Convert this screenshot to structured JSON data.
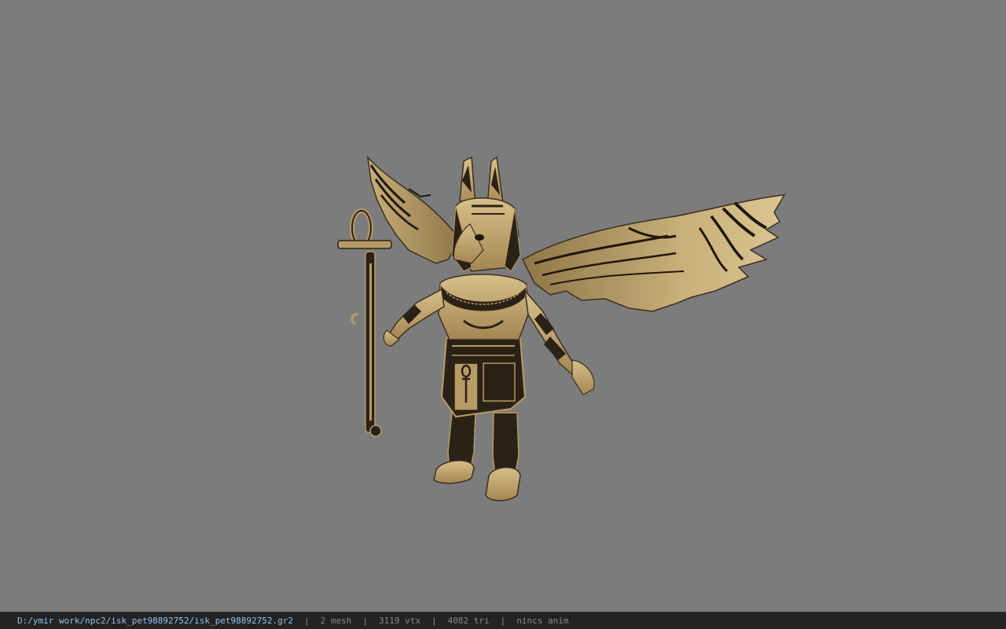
{
  "viewport": {
    "background_color": "#7c7c7c",
    "model": {
      "subject": "anubis-winged-pet-model",
      "material_colors": {
        "base": "#b89a64",
        "highlight": "#d8c08a",
        "shadow": "#3b2f1e",
        "dark_pattern": "#1e180f"
      }
    }
  },
  "status_bar": {
    "file_path": "D:/ymir work/npc2/isk_pet98892752/isk_pet98892752.gr2",
    "separator": "|",
    "mesh_count": "2 mesh",
    "vertex_count": "3119 vtx",
    "triangle_count": "4082 tri",
    "anim_status": "nincs anim",
    "colors": {
      "background": "#232323",
      "path_text": "#8fc4f0",
      "stat_text": "#8a8a8a"
    }
  }
}
